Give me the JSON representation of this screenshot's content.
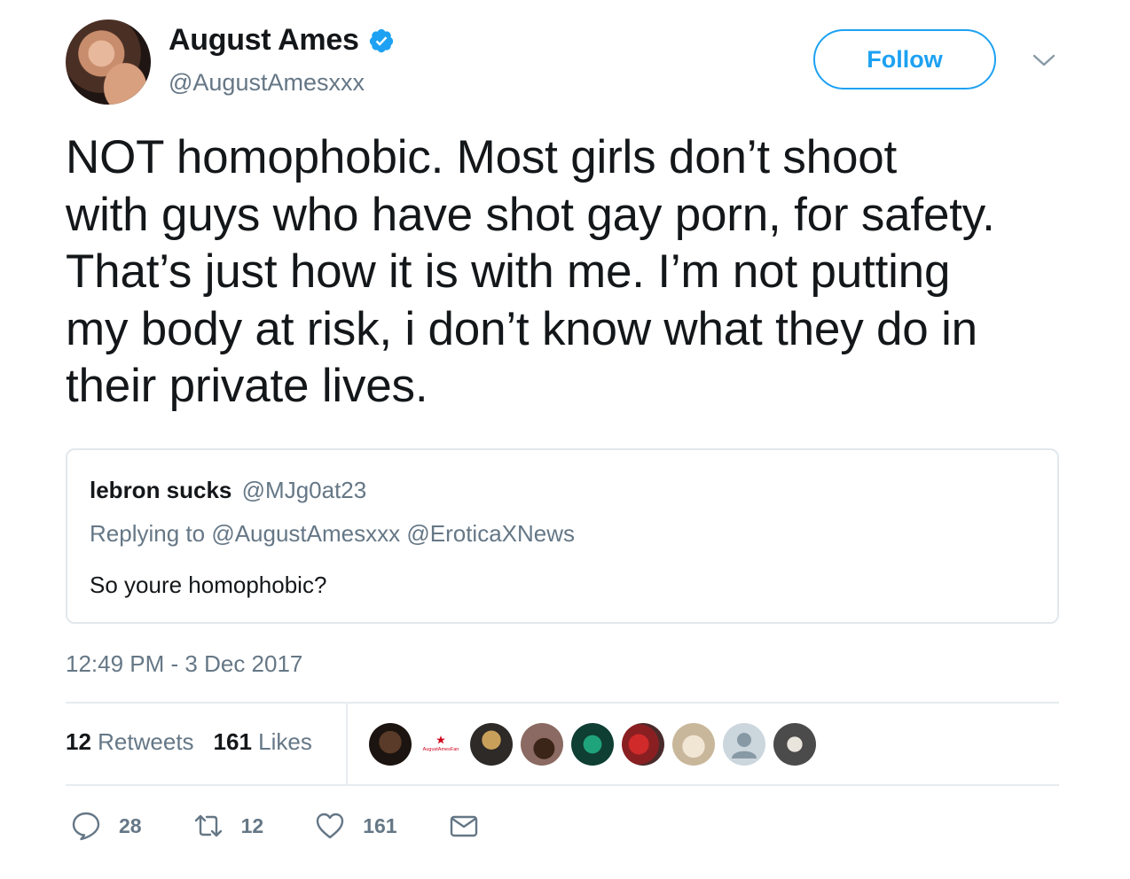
{
  "header": {
    "name": "August Ames",
    "handle": "@AugustAmesxxx",
    "follow_label": "Follow"
  },
  "tweet": {
    "text": "NOT homophobic. Most girls don’t shoot\nwith guys who have shot gay porn, for safety.\nThat’s just how it is with me. I’m not putting\nmy body at risk, i don’t know what they do in\ntheir private lives.",
    "timestamp": "12:49 PM - 3 Dec 2017"
  },
  "quoted": {
    "name": "lebron sucks",
    "handle": "@MJg0at23",
    "replying_prefix": "Replying to",
    "replying_to_1": "@AugustAmesxxx",
    "replying_to_2": "@EroticaXNews",
    "text": "So youre homophobic?"
  },
  "stats": {
    "retweets_count": "12",
    "retweets_label": "Retweets",
    "likes_count": "161",
    "likes_label": "Likes"
  },
  "likers": [
    {
      "icon": "liker-avatar-1"
    },
    {
      "icon": "liker-avatar-august-ames-fan",
      "text": "AugustAmesFan"
    },
    {
      "icon": "liker-avatar-3"
    },
    {
      "icon": "liker-avatar-4"
    },
    {
      "icon": "liker-avatar-5"
    },
    {
      "icon": "liker-avatar-6"
    },
    {
      "icon": "liker-avatar-7"
    },
    {
      "icon": "liker-avatar-default"
    },
    {
      "icon": "liker-avatar-9"
    }
  ],
  "actions": {
    "reply_count": "28",
    "retweet_count": "12",
    "like_count": "161"
  },
  "colors": {
    "accent": "#1da1f2",
    "text": "#14171a",
    "secondary": "#657786",
    "border": "#e1e8ed"
  }
}
